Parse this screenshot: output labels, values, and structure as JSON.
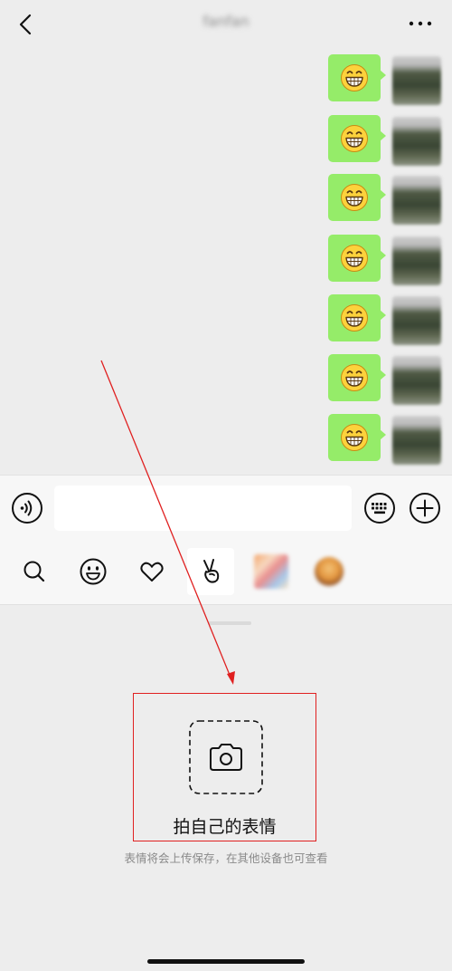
{
  "nav": {
    "title": "fanfan",
    "back_icon": "chevron-left-icon",
    "more_icon": "more-dots-icon"
  },
  "chat": {
    "bubble_color": "#95ec69",
    "messages": [
      {
        "sender": "self",
        "content": "grinning-emoji"
      },
      {
        "sender": "self",
        "content": "grinning-emoji"
      },
      {
        "sender": "self",
        "content": "grinning-emoji"
      },
      {
        "sender": "self",
        "content": "grinning-emoji"
      },
      {
        "sender": "self",
        "content": "grinning-emoji"
      },
      {
        "sender": "self",
        "content": "grinning-emoji"
      },
      {
        "sender": "self",
        "content": "grinning-emoji"
      }
    ]
  },
  "input_bar": {
    "voice_icon": "voice-icon",
    "keyboard_icon": "keyboard-icon",
    "plus_icon": "plus-circle-icon",
    "text_value": ""
  },
  "sticker_tabs": [
    {
      "icon": "search-icon",
      "active": false
    },
    {
      "icon": "smiley-icon",
      "active": false
    },
    {
      "icon": "heart-icon",
      "active": false
    },
    {
      "icon": "peace-hand-icon",
      "active": true
    },
    {
      "icon": "sticker-pack-thumbnail",
      "active": false
    },
    {
      "icon": "sticker-pack-thumbnail",
      "active": false
    }
  ],
  "self_sticker": {
    "label": "拍自己的表情",
    "note": "表情将会上传保存，在其他设备也可查看",
    "camera_icon": "camera-icon"
  },
  "colors": {
    "background": "#ededed",
    "highlight": "#e02020",
    "panel": "#f7f7f7"
  }
}
